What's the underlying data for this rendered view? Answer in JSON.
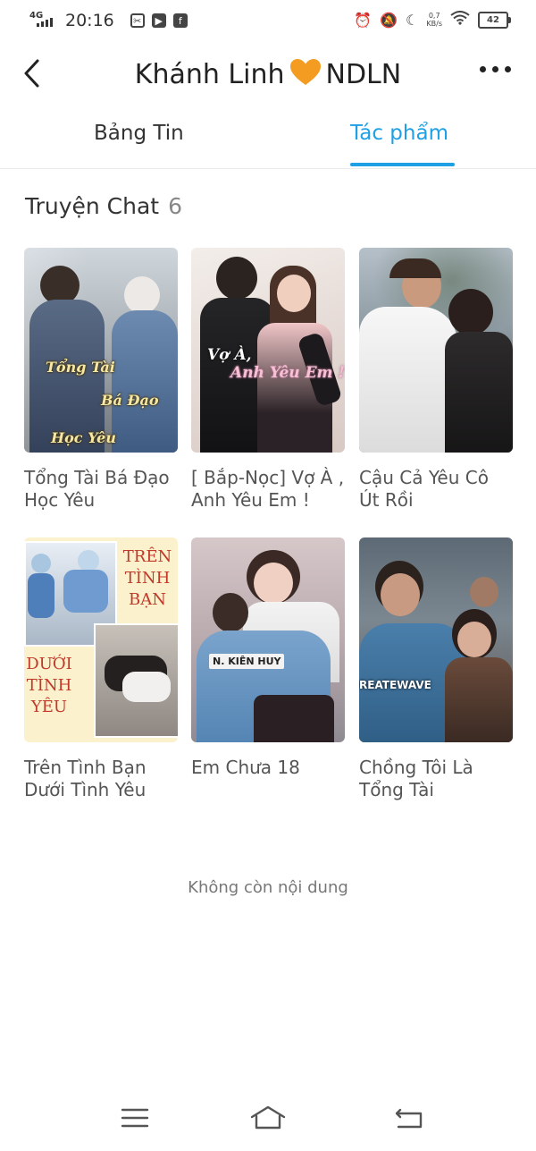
{
  "status_bar": {
    "network": "4G",
    "time": "20:16",
    "speed_value": "0,7",
    "speed_unit": "KB/s",
    "battery": "42"
  },
  "header": {
    "title_left": "Khánh Linh",
    "title_right": "NDLN"
  },
  "tabs": [
    {
      "label": "Bảng Tin",
      "active": false
    },
    {
      "label": "Tác phẩm",
      "active": true
    }
  ],
  "section": {
    "title": "Truyện Chat",
    "count": "6"
  },
  "stories": [
    {
      "title": "Tổng Tài Bá Đạo Học Yêu",
      "cover_text": [
        "Tổng Tài",
        "Bá Đạo",
        "Học Yêu"
      ]
    },
    {
      "title": "[ Bắp-Nọc] Vợ À , Anh Yêu Em !",
      "cover_text": [
        "Vợ À,",
        "Anh Yêu Em !"
      ]
    },
    {
      "title": "Cậu Cả Yêu Cô Út Rồi",
      "cover_text": []
    },
    {
      "title": "Trên Tình Bạn Dưới Tình Yêu",
      "cover_text": [
        "TRÊN",
        "TÌNH",
        "BẠN",
        "DƯỚI",
        "TÌNH",
        "YÊU"
      ]
    },
    {
      "title": "Em Chưa 18",
      "cover_text": [
        "N. KIÊN HUY"
      ]
    },
    {
      "title": "Chồng Tôi Là Tổng Tài",
      "cover_text": [
        "REATEWAVE"
      ]
    }
  ],
  "footer_text": "Không còn nội dung",
  "colors": {
    "accent": "#1fa0e4",
    "heart": "#f39c21"
  }
}
